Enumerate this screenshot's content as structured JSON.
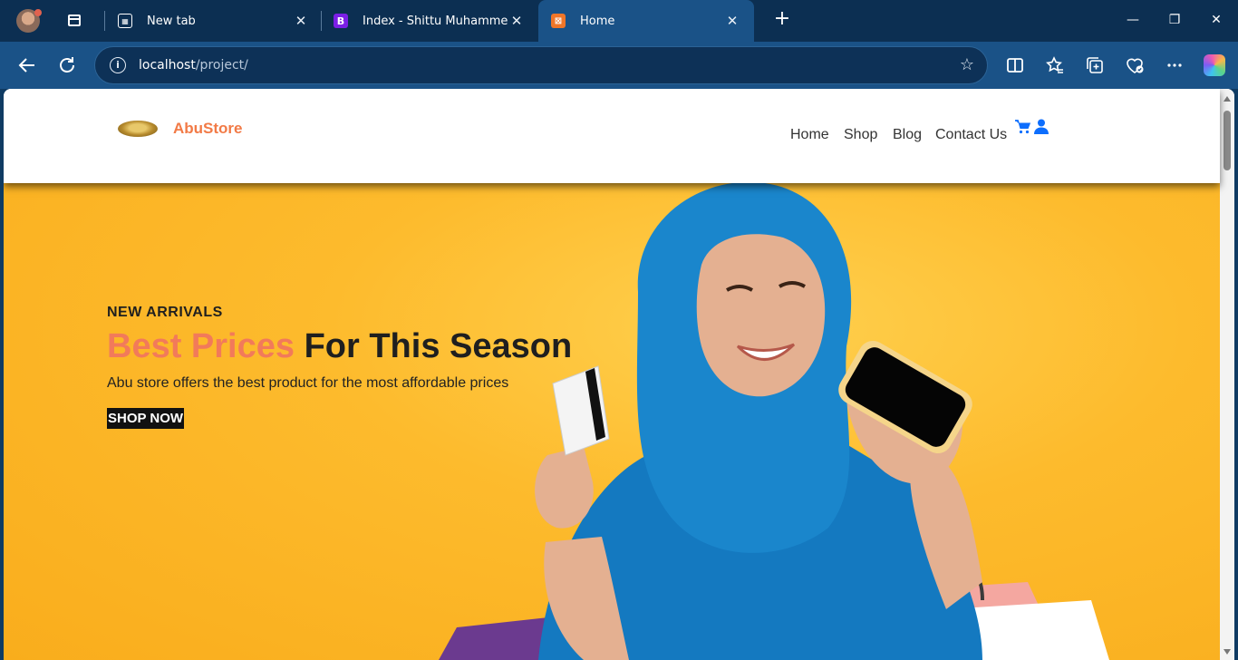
{
  "browser": {
    "tabs": [
      {
        "title": "New tab",
        "active": false
      },
      {
        "title": "Index - Shittu Muhammed",
        "active": false
      },
      {
        "title": "Home",
        "active": true
      }
    ],
    "close_glyph": "✕",
    "new_tab_glyph": "+",
    "window_controls": {
      "minimize": "—",
      "restore": "❐",
      "close": "✕"
    },
    "address": {
      "host": "localhost",
      "path": "/project/"
    },
    "icons": {
      "back": "back-arrow-icon",
      "refresh": "refresh-icon",
      "info": "site-info-icon",
      "favorite": "star-icon",
      "split": "split-screen-icon",
      "favorites": "favorites-icon",
      "collections": "collections-icon",
      "health": "browser-essentials-icon",
      "menu": "more-icon",
      "copilot": "copilot-icon"
    }
  },
  "site": {
    "brand": "AbuStore",
    "nav": [
      "Home",
      "Shop",
      "Blog",
      "Contact Us"
    ],
    "colors": {
      "brand": "#f27a46",
      "hero_bg": "#fdbb2d",
      "accent": "#f27a5a",
      "icon_blue": "#0d6efd"
    }
  },
  "hero": {
    "kicker": "NEW ARRIVALS",
    "headline_accent": "Best Prices",
    "headline_rest": "For This Season",
    "subtext": "Abu store offers the best product for the most affordable prices",
    "cta": "SHOP NOW"
  }
}
